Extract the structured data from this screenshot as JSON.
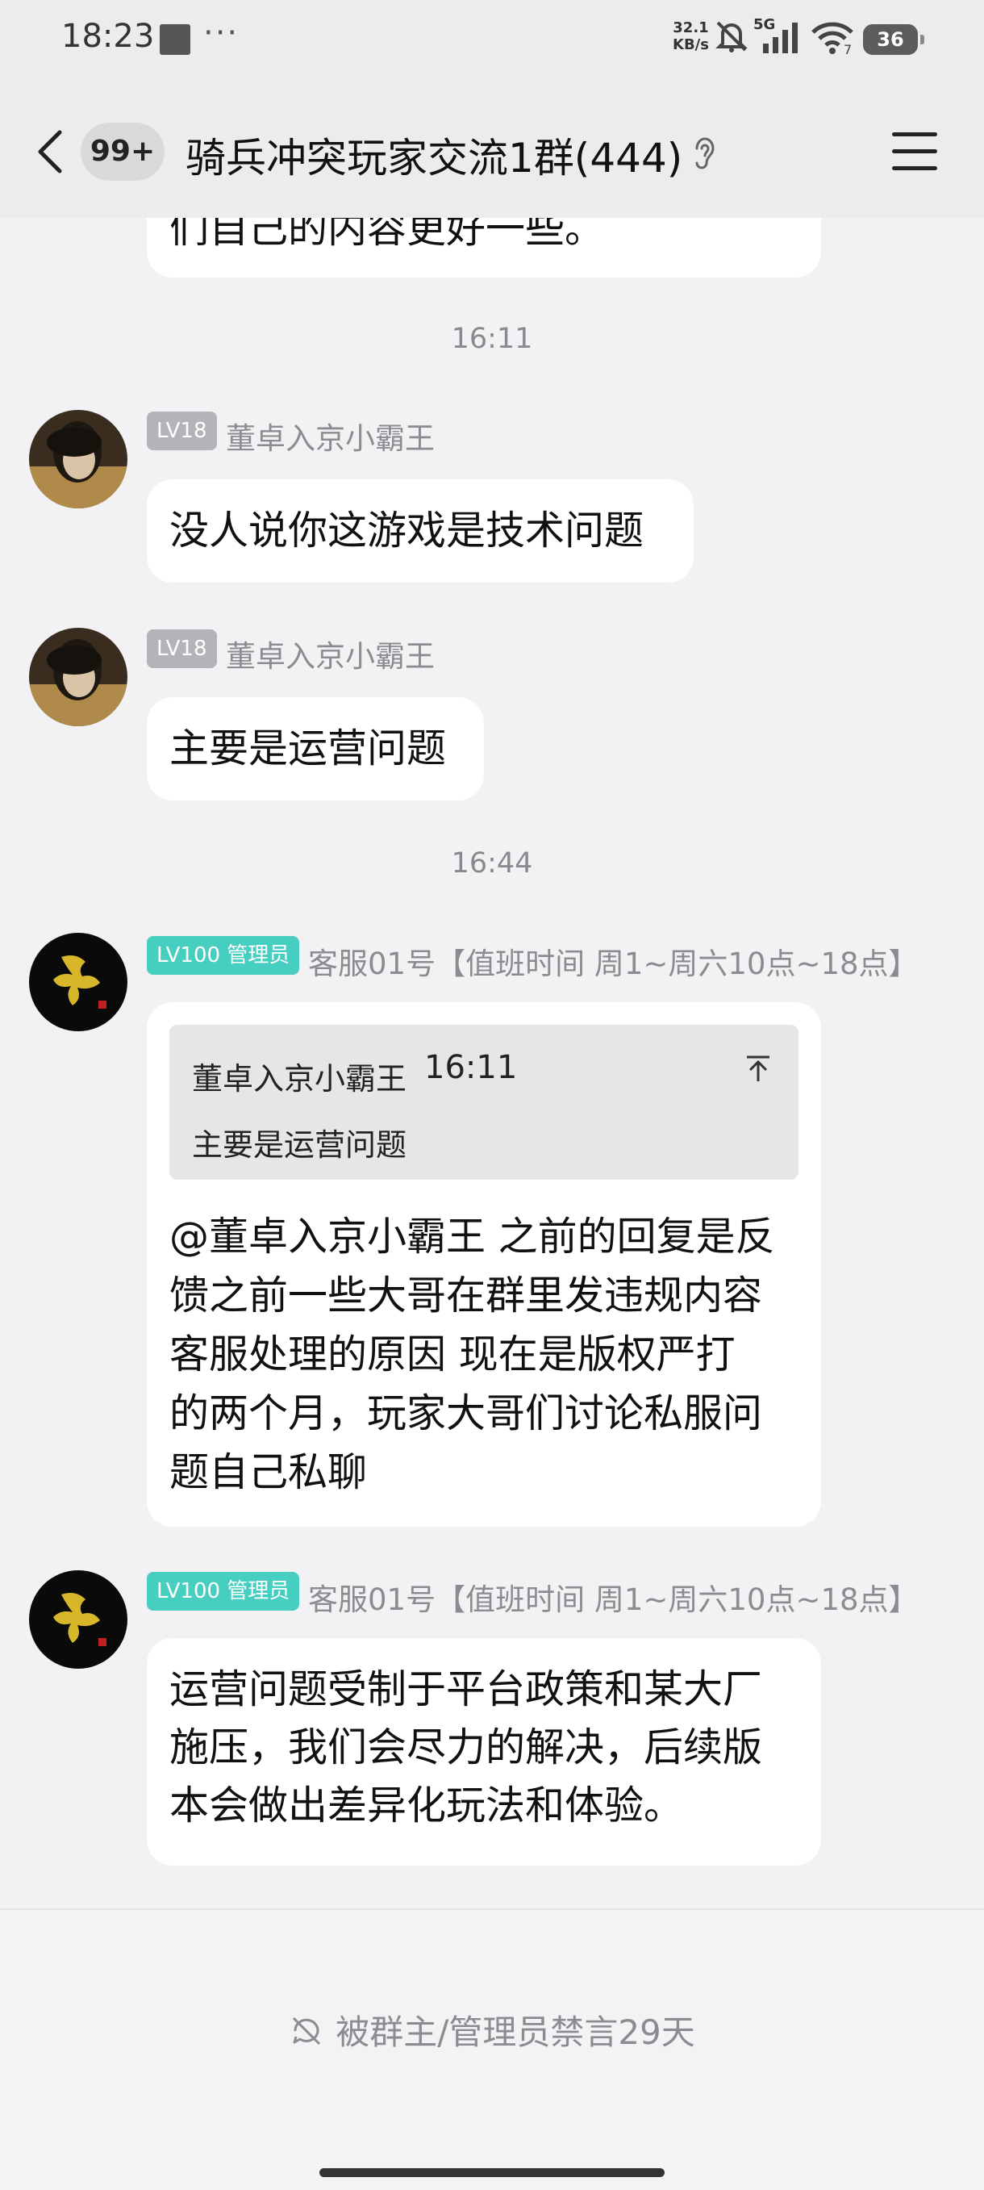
{
  "status_bar": {
    "time": "18:23",
    "more": "···",
    "net_speed_value": "32.1",
    "net_speed_unit": "KB/s",
    "signal_type": "5G",
    "wifi_level": "7",
    "battery": "36"
  },
  "header": {
    "unread_badge": "99+",
    "title": "骑兵冲突玩家交流1群(444)"
  },
  "messages": {
    "partial_top_text": "们自己的内容更好一些。",
    "time1": "16:11",
    "m1_level": "LV18",
    "m1_sender": "董卓入京小霸王",
    "m1_text": "没人说你这游戏是技术问题",
    "m2_level": "LV18",
    "m2_sender": "董卓入京小霸王",
    "m2_text": "主要是运营问题",
    "time2": "16:44",
    "m3_level": "LV100 管理员",
    "m3_sender": "客服01号【值班时间 周1~周六10点~18点】",
    "m3_quote_name": "董卓入京小霸王",
    "m3_quote_time": "16:11",
    "m3_quote_text": "主要是运营问题",
    "m3_line1": "@董卓入京小霸王 之前的回复是反",
    "m3_line2": "馈之前一些大哥在群里发违规内容",
    "m3_line3": "客服处理的原因  现在是版权严打",
    "m3_line4": "的两个月，玩家大哥们讨论私服问",
    "m3_line5": "题自己私聊",
    "m4_level": "LV100 管理员",
    "m4_sender": "客服01号【值班时间 周1~周六10点~18点】",
    "m4_line1": "运营问题受制于平台政策和某大厂",
    "m4_line2": "施压，我们会尽力的解决，后续版",
    "m4_line3": "本会做出差异化玩法和体验。"
  },
  "bottom": {
    "muted_text": "被群主/管理员禁言29天"
  },
  "colors": {
    "background": "#f2f2f4",
    "bubble": "#ffffff",
    "admin_badge": "#46cfc1",
    "level_badge": "#b4b4b8"
  }
}
